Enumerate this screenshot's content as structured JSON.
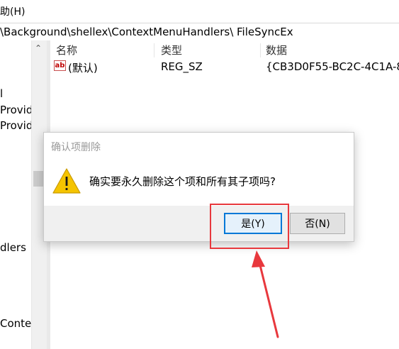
{
  "menubar": {
    "help_label": "助(H)"
  },
  "address": {
    "path": "\\Background\\shellex\\ContextMenuHandlers\\ FileSyncEx"
  },
  "tree": {
    "items": [
      {
        "label": "l"
      },
      {
        "label": "Provid"
      },
      {
        "label": "Provid"
      },
      {
        "label": "dlers"
      },
      {
        "label": "Contex"
      }
    ]
  },
  "list": {
    "columns": {
      "name": "名称",
      "type": "类型",
      "data": "数据"
    },
    "rows": [
      {
        "icon": "ab",
        "name": "(默认)",
        "type": "REG_SZ",
        "data": "{CB3D0F55-BC2C-4C1A-8"
      }
    ]
  },
  "dialog": {
    "title": "确认项删除",
    "message": "确实要永久删除这个项和所有其子项吗?",
    "yes_label": "是(Y)",
    "no_label": "否(N)"
  },
  "colors": {
    "highlight": "#e8383d",
    "warning": "#f5c400",
    "focus": "#0078d7"
  }
}
